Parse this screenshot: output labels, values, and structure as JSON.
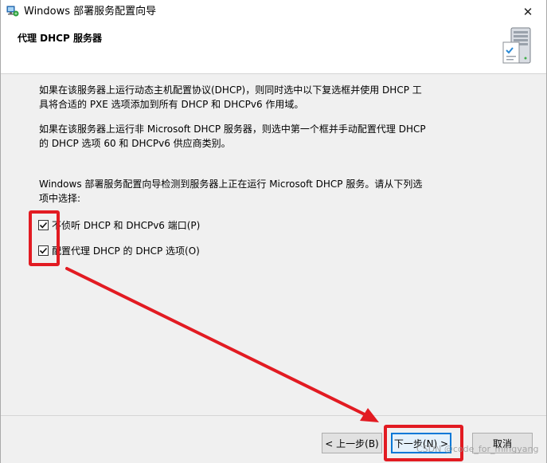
{
  "window": {
    "title": "Windows 部署服务配置向导",
    "close_glyph": "✕"
  },
  "header": {
    "title": "代理 DHCP 服务器",
    "icon": "server-icon"
  },
  "body": {
    "paragraph1": "如果在该服务器上运行动态主机配置协议(DHCP)，则同时选中以下复选框并使用 DHCP 工具将合适的 PXE 选项添加到所有 DHCP 和 DHCPv6 作用域。",
    "paragraph2": "如果在该服务器上运行非 Microsoft DHCP 服务器，则选中第一个框并手动配置代理 DHCP 的 DHCP 选项 60 和 DHCPv6 供应商类别。",
    "paragraph3": "Windows 部署服务配置向导检测到服务器上正在运行 Microsoft DHCP 服务。请从下列选项中选择:"
  },
  "options": [
    {
      "label": "不侦听 DHCP 和 DHCPv6 端口(P)",
      "checked": true
    },
    {
      "label": "配置代理 DHCP 的 DHCP 选项(O)",
      "checked": true
    }
  ],
  "buttons": {
    "back": "< 上一步(B)",
    "next": "下一步(N) >",
    "cancel": "取消"
  },
  "watermark": "CSDN @code_for_mingyang",
  "colors": {
    "annotation_red": "#e21b22",
    "focus_blue": "#0078d7"
  }
}
